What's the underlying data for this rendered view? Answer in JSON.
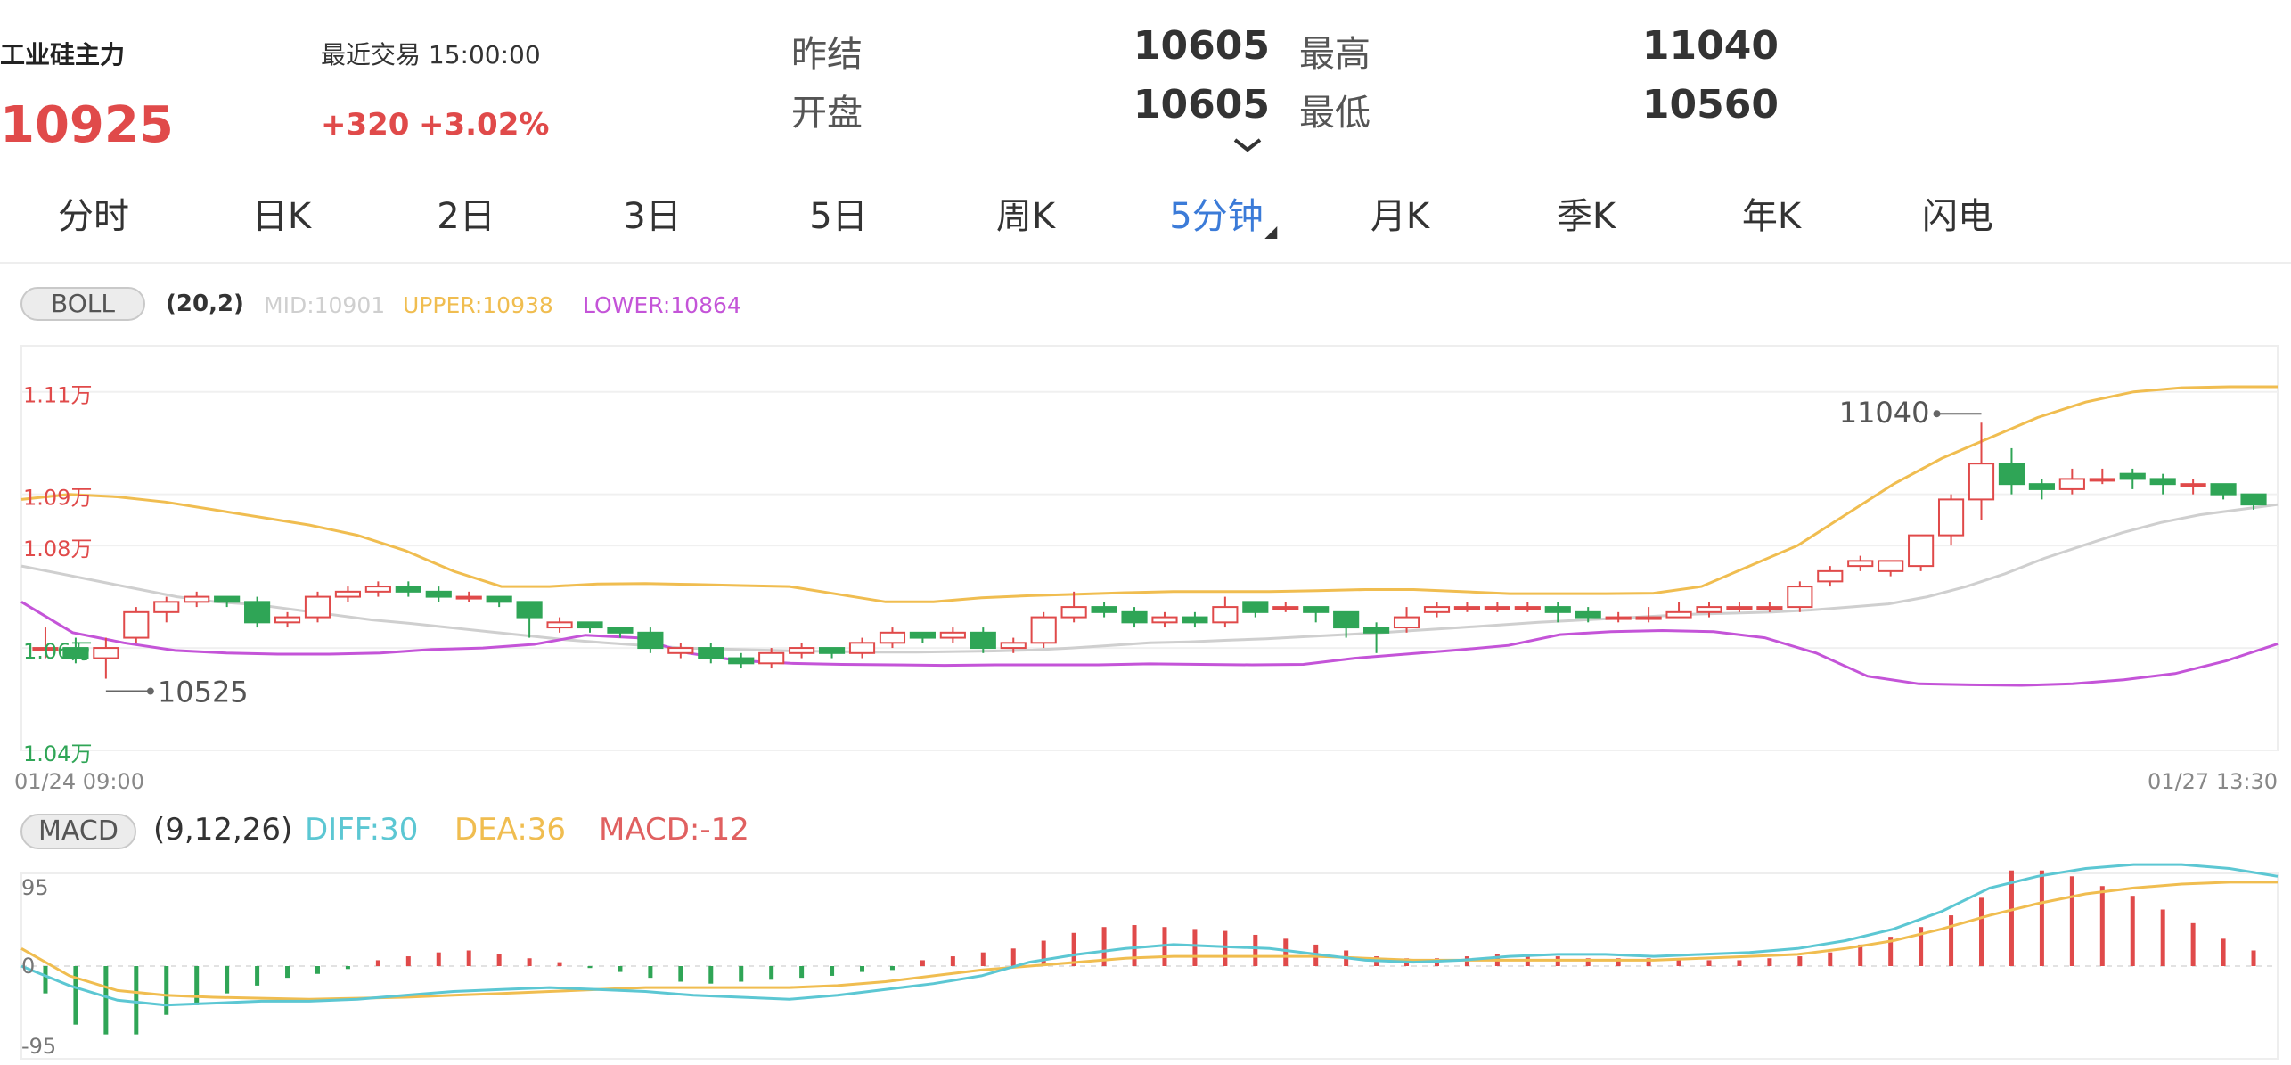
{
  "header": {
    "name": "工业硅主力",
    "last_trade_label": "最近交易",
    "last_trade_time": "15:00:00",
    "price": "10925",
    "change": "+320",
    "change_pct": "+3.02%",
    "prev_settle_label": "昨结",
    "prev_settle": "10605",
    "open_label": "开盘",
    "open": "10605",
    "high_label": "最高",
    "high": "11040",
    "low_label": "最低",
    "low": "10560"
  },
  "tabs": [
    {
      "label": "分时"
    },
    {
      "label": "日K"
    },
    {
      "label": "2日"
    },
    {
      "label": "3日"
    },
    {
      "label": "5日"
    },
    {
      "label": "周K"
    },
    {
      "label": "5分钟",
      "active": true
    },
    {
      "label": "月K"
    },
    {
      "label": "季K"
    },
    {
      "label": "年K"
    },
    {
      "label": "闪电"
    }
  ],
  "boll": {
    "button": "BOLL",
    "params": "(20,2)",
    "mid": "MID:10901",
    "upper": "UPPER:10938",
    "lower": "LOWER:10864"
  },
  "macd": {
    "button": "MACD",
    "params": "(9,12,26)",
    "diff": "DIFF:30",
    "dea": "DEA:36",
    "macd": "MACD:-12"
  },
  "colors": {
    "up": "#e04a4a",
    "down": "#2fa556",
    "mid": "#cfcfcf",
    "upper": "#f0bd50",
    "lower": "#c454d8",
    "diff": "#5cc7d3",
    "dea": "#f0bd50",
    "active_tab": "#3b7bd8"
  },
  "chart_data": [
    {
      "type": "candlestick",
      "y_tick_labels": [
        "1.11万",
        "1.09万",
        "1.08万",
        "1.06万",
        "1.04万"
      ],
      "y_ticks": [
        11100,
        10900,
        10800,
        10600,
        10400
      ],
      "ylim": [
        10400,
        11190
      ],
      "x_start_label": "01/24 09:00",
      "x_end_label": "01/27 13:30",
      "max_label": "11040",
      "min_label": "10525",
      "candles": [
        [
          10600,
          10600,
          10640,
          10580
        ],
        [
          10600,
          10580,
          10620,
          10570
        ],
        [
          10580,
          10600,
          10620,
          10540
        ],
        [
          10620,
          10670,
          10680,
          10610
        ],
        [
          10670,
          10690,
          10700,
          10650
        ],
        [
          10690,
          10700,
          10710,
          10680
        ],
        [
          10700,
          10690,
          10700,
          10680
        ],
        [
          10690,
          10650,
          10700,
          10640
        ],
        [
          10650,
          10660,
          10670,
          10640
        ],
        [
          10660,
          10700,
          10710,
          10650
        ],
        [
          10700,
          10710,
          10720,
          10690
        ],
        [
          10710,
          10720,
          10730,
          10700
        ],
        [
          10720,
          10710,
          10730,
          10700
        ],
        [
          10710,
          10700,
          10720,
          10690
        ],
        [
          10700,
          10700,
          10710,
          10690
        ],
        [
          10700,
          10690,
          10700,
          10680
        ],
        [
          10690,
          10660,
          10690,
          10620
        ],
        [
          10640,
          10650,
          10660,
          10630
        ],
        [
          10650,
          10640,
          10650,
          10630
        ],
        [
          10640,
          10630,
          10640,
          10620
        ],
        [
          10630,
          10600,
          10640,
          10590
        ],
        [
          10590,
          10600,
          10610,
          10580
        ],
        [
          10600,
          10580,
          10610,
          10570
        ],
        [
          10580,
          10570,
          10590,
          10560
        ],
        [
          10570,
          10590,
          10600,
          10560
        ],
        [
          10590,
          10600,
          10610,
          10580
        ],
        [
          10600,
          10590,
          10600,
          10580
        ],
        [
          10590,
          10610,
          10620,
          10580
        ],
        [
          10610,
          10630,
          10640,
          10600
        ],
        [
          10630,
          10620,
          10630,
          10610
        ],
        [
          10620,
          10630,
          10640,
          10610
        ],
        [
          10630,
          10600,
          10640,
          10590
        ],
        [
          10600,
          10610,
          10620,
          10590
        ],
        [
          10610,
          10660,
          10670,
          10600
        ],
        [
          10660,
          10680,
          10710,
          10650
        ],
        [
          10680,
          10670,
          10690,
          10660
        ],
        [
          10670,
          10650,
          10680,
          10640
        ],
        [
          10650,
          10660,
          10670,
          10640
        ],
        [
          10660,
          10650,
          10670,
          10640
        ],
        [
          10650,
          10680,
          10700,
          10640
        ],
        [
          10690,
          10670,
          10690,
          10660
        ],
        [
          10680,
          10680,
          10690,
          10670
        ],
        [
          10680,
          10670,
          10680,
          10650
        ],
        [
          10670,
          10640,
          10670,
          10620
        ],
        [
          10640,
          10630,
          10650,
          10590
        ],
        [
          10640,
          10660,
          10680,
          10630
        ],
        [
          10670,
          10680,
          10690,
          10660
        ],
        [
          10680,
          10680,
          10690,
          10670
        ],
        [
          10680,
          10680,
          10690,
          10670
        ],
        [
          10680,
          10680,
          10690,
          10670
        ],
        [
          10680,
          10670,
          10690,
          10650
        ],
        [
          10670,
          10660,
          10680,
          10650
        ],
        [
          10660,
          10660,
          10670,
          10650
        ],
        [
          10660,
          10660,
          10680,
          10650
        ],
        [
          10660,
          10670,
          10690,
          10660
        ],
        [
          10670,
          10680,
          10690,
          10660
        ],
        [
          10680,
          10680,
          10690,
          10670
        ],
        [
          10680,
          10680,
          10690,
          10670
        ],
        [
          10680,
          10720,
          10730,
          10670
        ],
        [
          10730,
          10750,
          10760,
          10720
        ],
        [
          10760,
          10770,
          10780,
          10750
        ],
        [
          10750,
          10770,
          10770,
          10740
        ],
        [
          10760,
          10820,
          10820,
          10750
        ],
        [
          10820,
          10890,
          10900,
          10800
        ],
        [
          10890,
          10960,
          11040,
          10850
        ],
        [
          10960,
          10920,
          10990,
          10900
        ],
        [
          10920,
          10910,
          10930,
          10890
        ],
        [
          10910,
          10930,
          10950,
          10900
        ],
        [
          10930,
          10930,
          10950,
          10920
        ],
        [
          10940,
          10930,
          10950,
          10910
        ],
        [
          10930,
          10920,
          10940,
          10900
        ],
        [
          10920,
          10920,
          10930,
          10900
        ],
        [
          10920,
          10900,
          10920,
          10890
        ],
        [
          10900,
          10880,
          10900,
          10870
        ]
      ],
      "boll_mid": [
        10760,
        10745,
        10730,
        10715,
        10700,
        10690,
        10685,
        10675,
        10665,
        10655,
        10648,
        10640,
        10632,
        10624,
        10616,
        10610,
        10605,
        10600,
        10598,
        10596,
        10594,
        10593,
        10592,
        10592,
        10593,
        10594,
        10596,
        10600,
        10605,
        10610,
        10612,
        10615,
        10618,
        10622,
        10626,
        10630,
        10635,
        10640,
        10645,
        10650,
        10654,
        10658,
        10662,
        10666,
        10668,
        10670,
        10674,
        10680,
        10686,
        10700,
        10720,
        10745,
        10775,
        10800,
        10825,
        10845,
        10860,
        10870,
        10880
      ],
      "boll_upper": [
        10890,
        10900,
        10895,
        10885,
        10870,
        10855,
        10840,
        10820,
        10790,
        10750,
        10720,
        10720,
        10725,
        10726,
        10724,
        10722,
        10720,
        10705,
        10690,
        10690,
        10698,
        10702,
        10705,
        10708,
        10710,
        10710,
        10710,
        10712,
        10714,
        10714,
        10710,
        10706,
        10706,
        10706,
        10707,
        10720,
        10760,
        10800,
        10860,
        10920,
        10970,
        11010,
        11050,
        11080,
        11100,
        11108,
        11110,
        11110
      ],
      "boll_lower": [
        10690,
        10630,
        10610,
        10595,
        10590,
        10588,
        10588,
        10590,
        10597,
        10600,
        10607,
        10625,
        10620,
        10590,
        10575,
        10570,
        10568,
        10567,
        10566,
        10567,
        10567,
        10567,
        10569,
        10568,
        10567,
        10568,
        10580,
        10588,
        10596,
        10605,
        10626,
        10632,
        10634,
        10632,
        10620,
        10590,
        10545,
        10530,
        10528,
        10527,
        10530,
        10538,
        10550,
        10575,
        10608
      ],
      "macd_ylim": [
        -95,
        95
      ],
      "macd_bars": [
        -28,
        -60,
        -70,
        -70,
        -50,
        -40,
        -28,
        -20,
        -12,
        -8,
        -3,
        6,
        10,
        14,
        16,
        12,
        8,
        4,
        -2,
        -6,
        -12,
        -16,
        -18,
        -16,
        -14,
        -12,
        -10,
        -6,
        -4,
        6,
        10,
        14,
        18,
        26,
        34,
        40,
        42,
        40,
        38,
        36,
        32,
        28,
        22,
        16,
        10,
        8,
        8,
        10,
        12,
        12,
        10,
        8,
        8,
        8,
        8,
        6,
        6,
        8,
        10,
        14,
        22,
        30,
        40,
        52,
        70,
        98,
        98,
        92,
        82,
        72,
        58,
        44,
        28,
        16
      ],
      "diff": [
        0,
        -20,
        -35,
        -40,
        -38,
        -36,
        -36,
        -34,
        -30,
        -26,
        -24,
        -22,
        -24,
        -26,
        -30,
        -32,
        -34,
        -30,
        -24,
        -18,
        -10,
        4,
        12,
        18,
        22,
        20,
        18,
        12,
        6,
        4,
        6,
        10,
        12,
        12,
        10,
        12,
        14,
        18,
        26,
        38,
        56,
        80,
        92,
        100,
        104,
        104,
        100,
        92
      ],
      "dea": [
        18,
        -10,
        -25,
        -30,
        -32,
        -33,
        -34,
        -33,
        -32,
        -30,
        -28,
        -26,
        -24,
        -22,
        -22,
        -22,
        -22,
        -20,
        -16,
        -10,
        -4,
        0,
        4,
        8,
        10,
        10,
        10,
        10,
        8,
        6,
        6,
        6,
        6,
        6,
        6,
        8,
        10,
        12,
        18,
        26,
        38,
        52,
        64,
        74,
        80,
        84,
        86,
        86
      ]
    }
  ]
}
